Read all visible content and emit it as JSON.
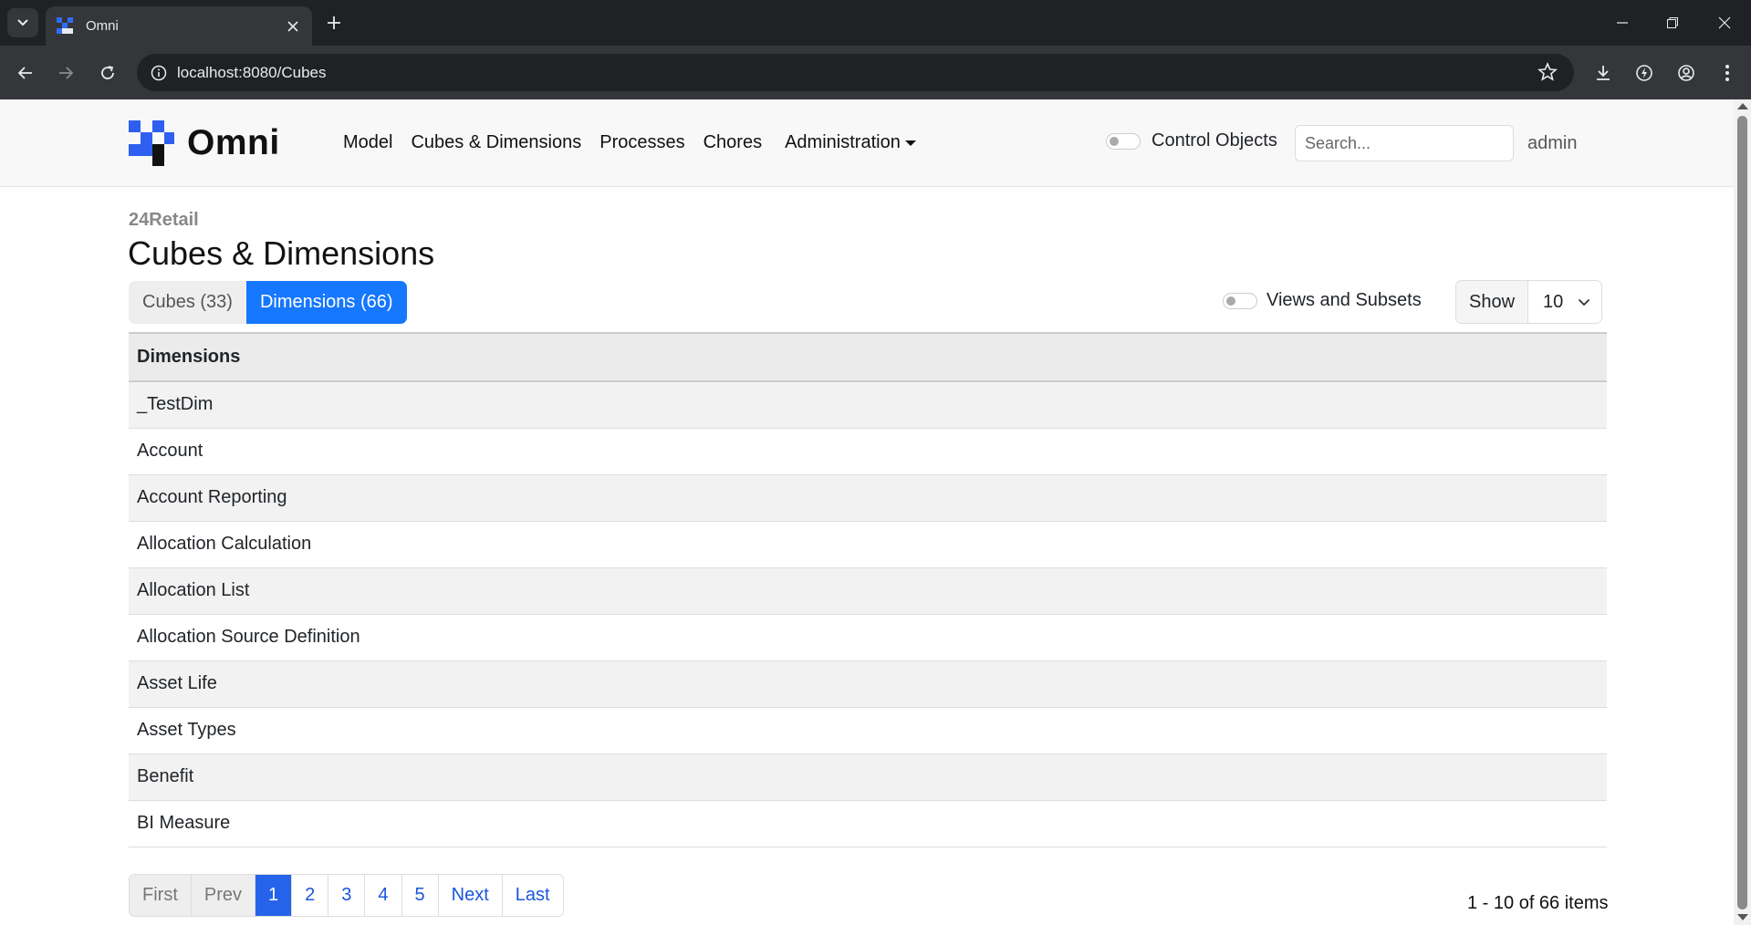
{
  "browser": {
    "tab_title": "Omni",
    "url": "localhost:8080/Cubes"
  },
  "navbar": {
    "brand": "Omni",
    "menu": [
      "Model",
      "Cubes & Dimensions",
      "Processes",
      "Chores"
    ],
    "admin_menu": "Administration",
    "control_objects_label": "Control Objects",
    "search_placeholder": "Search...",
    "user": "admin"
  },
  "main": {
    "breadcrumb": "24Retail",
    "title": "Cubes & Dimensions",
    "tabs": [
      {
        "label": "Cubes (33)",
        "active": false
      },
      {
        "label": "Dimensions (66)",
        "active": true
      }
    ],
    "views_toggle_label": "Views and Subsets",
    "show_label": "Show",
    "show_value": "10"
  },
  "table": {
    "header": "Dimensions",
    "rows": [
      "_TestDim",
      "Account",
      "Account Reporting",
      "Allocation Calculation",
      "Allocation List",
      "Allocation Source Definition",
      "Asset Life",
      "Asset Types",
      "Benefit",
      "BI Measure"
    ]
  },
  "pagination": {
    "first": "First",
    "prev": "Prev",
    "pages": [
      "1",
      "2",
      "3",
      "4",
      "5"
    ],
    "current": "1",
    "next": "Next",
    "last": "Last",
    "summary": "1 - 10 of 66 items"
  },
  "colors": {
    "accent": "#1677ff",
    "page_current": "#2563eb"
  }
}
